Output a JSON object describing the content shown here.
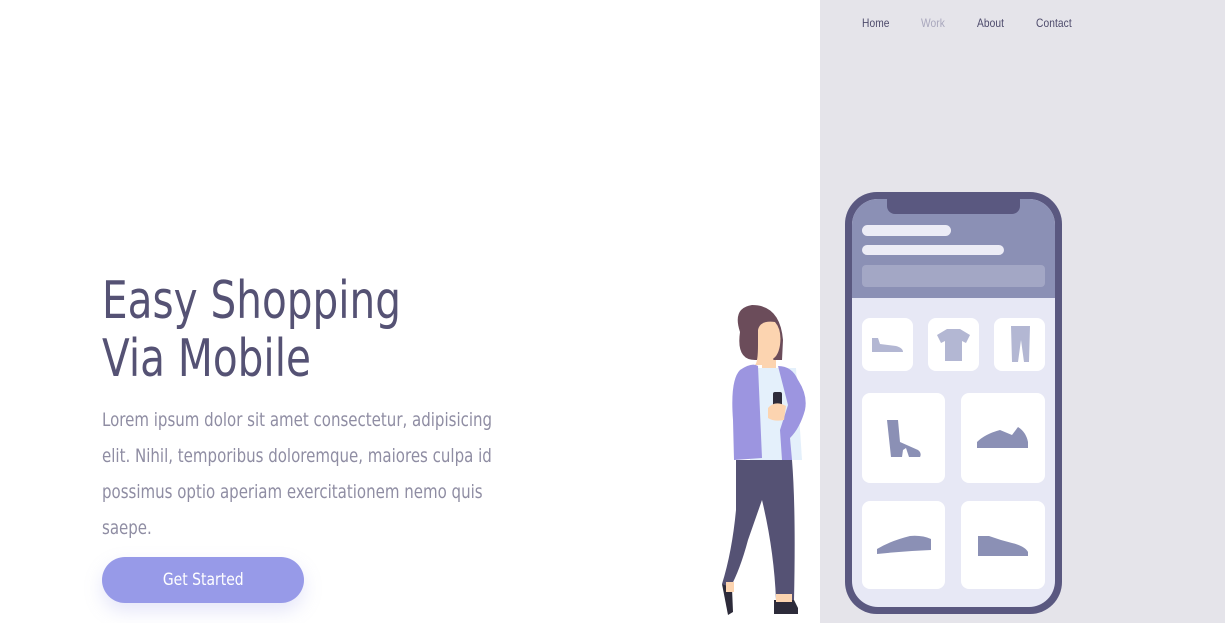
{
  "nav": {
    "items": [
      {
        "label": "Home"
      },
      {
        "label": "Work"
      },
      {
        "label": "About"
      },
      {
        "label": "Contact"
      }
    ]
  },
  "hero": {
    "title_line1": "Easy Shopping",
    "title_line2": "Via Mobile",
    "description": "Lorem ipsum dolor sit amet consectetur, adipisicing elit. Nihil, temporibus doloremque, maiores culpa id possimus optio aperiam exercitationem nemo quis saepe.",
    "cta_label": "Get Started"
  },
  "colors": {
    "accent": "#979ae8",
    "title": "#555274",
    "body_text": "#8f8da3",
    "panel_bg": "#e5e4ea",
    "phone_frame": "#5a5880"
  }
}
